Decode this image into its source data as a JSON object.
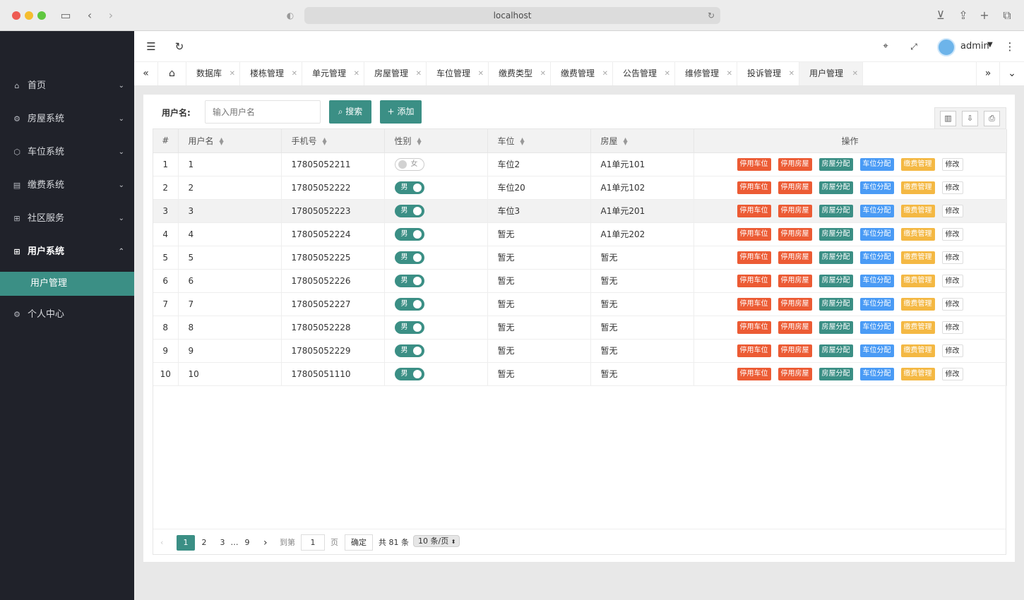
{
  "browser": {
    "url": "localhost"
  },
  "sidebar": {
    "items": [
      {
        "label": "首页",
        "icon": "home-icon"
      },
      {
        "label": "房屋系统",
        "icon": "gear-icon"
      },
      {
        "label": "车位系统",
        "icon": "box-icon"
      },
      {
        "label": "缴费系统",
        "icon": "list-icon"
      },
      {
        "label": "社区服务",
        "icon": "grid-icon"
      },
      {
        "label": "用户系统",
        "icon": "grid-icon"
      },
      {
        "label": "个人中心",
        "icon": "gear-icon"
      }
    ],
    "sub_item": "用户管理"
  },
  "header": {
    "username": "admin"
  },
  "tabs": [
    "数据库",
    "楼栋管理",
    "单元管理",
    "房屋管理",
    "车位管理",
    "缴费类型",
    "缴费管理",
    "公告管理",
    "维修管理",
    "投诉管理",
    "用户管理"
  ],
  "search": {
    "label": "用户名:",
    "placeholder": "输入用户名",
    "search_btn": "搜索",
    "add_btn": "添加"
  },
  "table": {
    "headers": [
      "#",
      "用户名",
      "手机号",
      "性别",
      "车位",
      "房屋",
      "操作"
    ],
    "rows": [
      {
        "no": "1",
        "username": "1",
        "phone": "17805052211",
        "gender": "女",
        "gender_on": false,
        "parking": "车位2",
        "house": "A1单元101"
      },
      {
        "no": "2",
        "username": "2",
        "phone": "17805052222",
        "gender": "男",
        "gender_on": true,
        "parking": "车位20",
        "house": "A1单元102"
      },
      {
        "no": "3",
        "username": "3",
        "phone": "17805052223",
        "gender": "男",
        "gender_on": true,
        "parking": "车位3",
        "house": "A1单元201"
      },
      {
        "no": "4",
        "username": "4",
        "phone": "17805052224",
        "gender": "男",
        "gender_on": true,
        "parking": "暂无",
        "house": "A1单元202"
      },
      {
        "no": "5",
        "username": "5",
        "phone": "17805052225",
        "gender": "男",
        "gender_on": true,
        "parking": "暂无",
        "house": "暂无"
      },
      {
        "no": "6",
        "username": "6",
        "phone": "17805052226",
        "gender": "男",
        "gender_on": true,
        "parking": "暂无",
        "house": "暂无"
      },
      {
        "no": "7",
        "username": "7",
        "phone": "17805052227",
        "gender": "男",
        "gender_on": true,
        "parking": "暂无",
        "house": "暂无"
      },
      {
        "no": "8",
        "username": "8",
        "phone": "17805052228",
        "gender": "男",
        "gender_on": true,
        "parking": "暂无",
        "house": "暂无"
      },
      {
        "no": "9",
        "username": "9",
        "phone": "17805052229",
        "gender": "男",
        "gender_on": true,
        "parking": "暂无",
        "house": "暂无"
      },
      {
        "no": "10",
        "username": "10",
        "phone": "17805051110",
        "gender": "男",
        "gender_on": true,
        "parking": "暂无",
        "house": "暂无"
      }
    ],
    "actions": [
      {
        "label": "停用车位",
        "color": "red"
      },
      {
        "label": "停用房屋",
        "color": "red"
      },
      {
        "label": "房屋分配",
        "color": "green"
      },
      {
        "label": "车位分配",
        "color": "blue"
      },
      {
        "label": "缴费管理",
        "color": "yellow"
      },
      {
        "label": "修改",
        "color": "edit"
      }
    ]
  },
  "pagination": {
    "pages": [
      "1",
      "2",
      "3",
      "…",
      "9"
    ],
    "goto_label": "到第",
    "goto_value": "1",
    "page_unit": "页",
    "confirm": "确定",
    "total": "共 81 条",
    "per_page": "10 条/页"
  },
  "colors": {
    "accent": "#3b8f85",
    "sidebar_bg": "#20222a",
    "danger": "#ec5b34",
    "info": "#4a9bf5",
    "warning": "#f4b843"
  }
}
